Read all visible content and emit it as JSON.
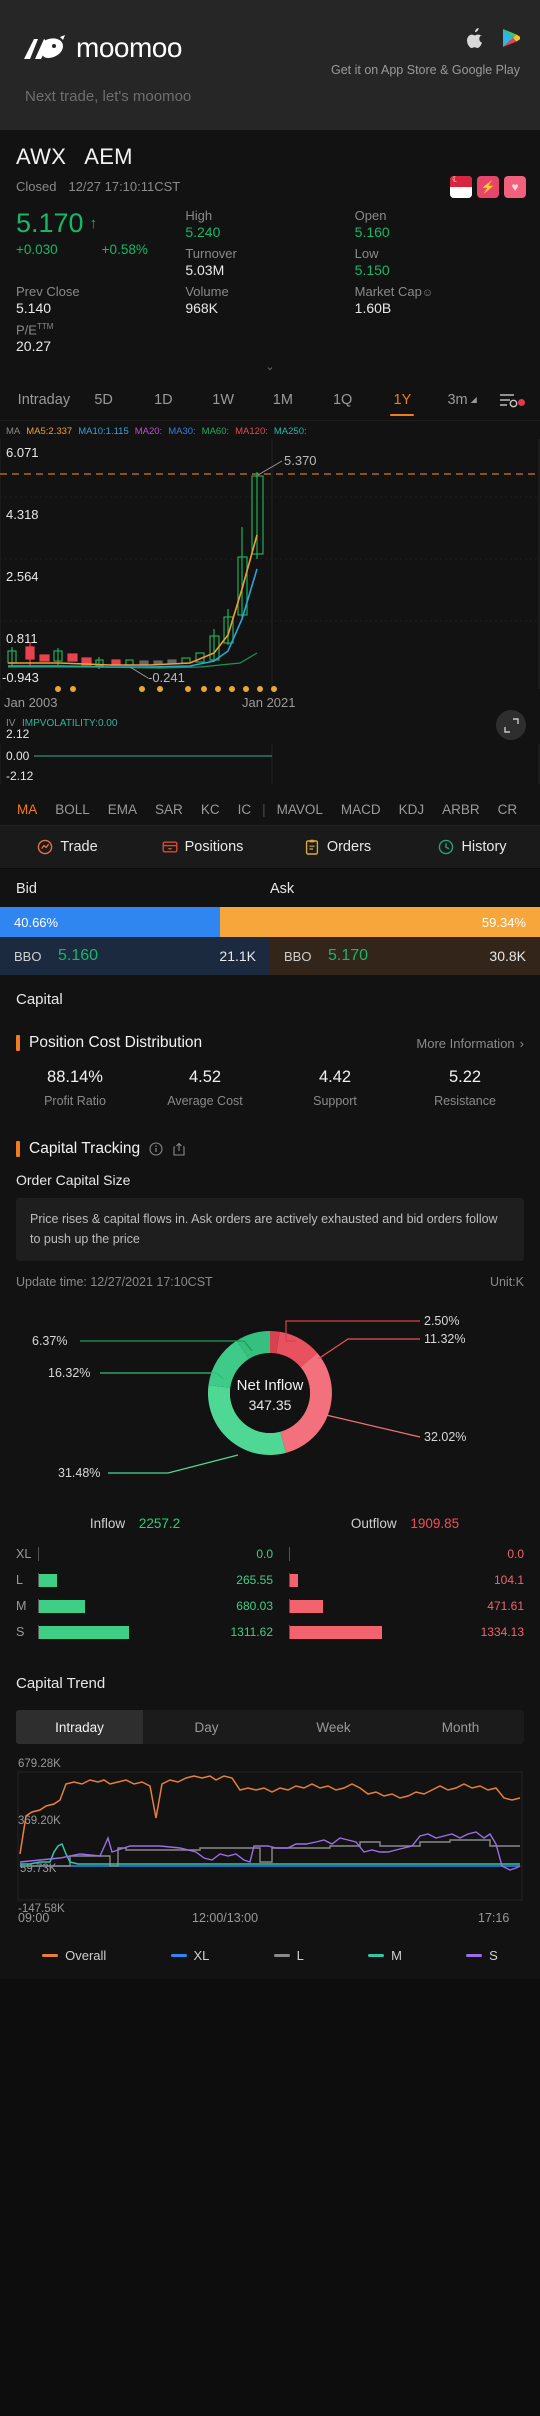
{
  "promo": {
    "brand": "moomoo",
    "tagline": "Next trade, let's moomoo",
    "store_text": "Get it on App Store & Google Play",
    "apple_icon": "apple-icon",
    "googleplay_icon": "google-play-icon"
  },
  "ticker": {
    "symbol": "AWX",
    "market": "AEM",
    "status": "Closed",
    "timestamp": "12/27 17:10:11CST",
    "badges": [
      "sg-flag-badge",
      "level1-badge",
      "watchlist-heart-badge"
    ]
  },
  "quote": {
    "price": "5.170",
    "arrow": "↑",
    "change": "+0.030",
    "change_pct": "+0.58%",
    "stats": [
      {
        "label": "High",
        "value": "5.240",
        "cls": "up"
      },
      {
        "label": "Open",
        "value": "5.160",
        "cls": "up"
      },
      {
        "label": "Turnover",
        "value": "5.03M",
        "cls": ""
      },
      {
        "label": "Low",
        "value": "5.150",
        "cls": "up"
      },
      {
        "label": "Prev Close",
        "value": "5.140",
        "cls": ""
      },
      {
        "label": "Volume",
        "value": "968K",
        "cls": ""
      },
      {
        "label": "Market Cap",
        "value": "1.60B",
        "cls": ""
      },
      {
        "label": "P/E",
        "value": "20.27",
        "cls": ""
      }
    ],
    "market_cap_info": "☺",
    "pe_sup": "TTM",
    "expand_caret": "⌄"
  },
  "timeframes": {
    "items": [
      "Intraday",
      "5D",
      "1D",
      "1W",
      "1M",
      "1Q",
      "1Y",
      "3m"
    ],
    "active": "1Y",
    "caret": "◢",
    "settings_icon": "chart-settings-icon"
  },
  "chart": {
    "ma_prefix": "MA",
    "ma_items": [
      {
        "label": "MA5:2.337",
        "color": "#f0a030"
      },
      {
        "label": "MA10:1.115",
        "color": "#2ea3d8"
      },
      {
        "label": "MA20:",
        "color": "#c24bd8"
      },
      {
        "label": "MA30:",
        "color": "#2f7fe8"
      },
      {
        "label": "MA60:",
        "color": "#1fae5a"
      },
      {
        "label": "MA120:",
        "color": "#e04a58"
      },
      {
        "label": "MA250:",
        "color": "#1fb8a8"
      }
    ],
    "y_labels": [
      "6.071",
      "4.318",
      "2.564",
      "0.811",
      "-0.943"
    ],
    "x_labels": [
      "Jan 2003",
      "Jan 2021"
    ],
    "callout_high": "5.370",
    "callout_low": "-0.241",
    "iv_prefix": "IV",
    "iv_label": "IMPVOLATILITY:0.00",
    "iv_y": [
      "2.12",
      "0.00",
      "-2.12"
    ],
    "expand_icon": "expand-chart-icon",
    "indicators_left": [
      "MA",
      "BOLL",
      "EMA",
      "SAR",
      "KC",
      "IC"
    ],
    "indicators_right": [
      "MAVOL",
      "MACD",
      "KDJ",
      "ARBR",
      "CR"
    ],
    "indicator_active": "MA",
    "indicator_sep": "|"
  },
  "actions": [
    {
      "label": "Trade",
      "icon": "trade-icon",
      "color": "#e8704a"
    },
    {
      "label": "Positions",
      "icon": "positions-icon",
      "color": "#d8483a"
    },
    {
      "label": "Orders",
      "icon": "orders-icon",
      "color": "#d8a93a"
    },
    {
      "label": "History",
      "icon": "history-clock-icon",
      "color": "#2a9e7e"
    }
  ],
  "bidask": {
    "bid_label": "Bid",
    "ask_label": "Ask",
    "bid_pct": "40.66%",
    "ask_pct": "59.34%",
    "bid_pct_num": 40.66,
    "ask_pct_num": 59.34,
    "bid_tag": "BBO",
    "bid_price": "5.160",
    "bid_qty": "21.1K",
    "ask_tag": "BBO",
    "ask_price": "5.170",
    "ask_qty": "30.8K",
    "bar_bid_color": "#2f86f0",
    "bar_ask_color": "#f7a63b"
  },
  "capital": {
    "title": "Capital"
  },
  "pcd": {
    "title": "Position Cost Distribution",
    "more": "More Information",
    "chevron": "›",
    "metrics": [
      {
        "value": "88.14%",
        "label": "Profit Ratio"
      },
      {
        "value": "4.52",
        "label": "Average Cost"
      },
      {
        "value": "4.42",
        "label": "Support"
      },
      {
        "value": "5.22",
        "label": "Resistance"
      }
    ]
  },
  "tracking": {
    "title": "Capital Tracking",
    "info_icon": "info-circle-icon",
    "share_icon": "share-icon",
    "subtitle": "Order Capital Size",
    "notice": "Price rises & capital flows in. Ask orders are actively exhausted and bid orders follow to push up the price",
    "update_prefix": "Update time:",
    "update_time": "12/27/2021 17:10CST",
    "unit": "Unit:K"
  },
  "chart_data": {
    "type": "pie",
    "title": "Net Inflow",
    "center_label": "Net Inflow",
    "center_value": "347.35",
    "labels": [
      "6.37%",
      "16.32%",
      "31.48%",
      "32.02%",
      "11.32%",
      "2.50%"
    ],
    "values": [
      6.37,
      16.32,
      31.48,
      32.02,
      11.32,
      2.5
    ],
    "colors": [
      "#1c9e52",
      "#2fbf72",
      "#4fd894",
      "#f2717d",
      "#e8525f",
      "#d8414f"
    ],
    "legend_position": "labels-outside",
    "inflow_label": "Inflow",
    "inflow_total": "2257.2",
    "outflow_label": "Outflow",
    "outflow_total": "1909.85",
    "flow_rows": [
      {
        "key": "XL",
        "in": "0.0",
        "out": "0.0",
        "in_num": 0.0,
        "out_num": 0.0
      },
      {
        "key": "L",
        "in": "265.55",
        "out": "104.1",
        "in_num": 265.55,
        "out_num": 104.1
      },
      {
        "key": "M",
        "in": "680.03",
        "out": "471.61",
        "in_num": 680.03,
        "out_num": 471.61
      },
      {
        "key": "S",
        "in": "1311.62",
        "out": "1334.13",
        "in_num": 1311.62,
        "out_num": 1334.13
      }
    ]
  },
  "trend": {
    "title": "Capital Trend",
    "tabs": [
      "Intraday",
      "Day",
      "Week",
      "Month"
    ],
    "active_tab": "Intraday",
    "y_labels": [
      "679.28K",
      "369.20K",
      "59.73K",
      "-147.58K"
    ],
    "y_mid_label": "59.73K",
    "x_labels": [
      "09:00",
      "12:00/13:00",
      "17:16"
    ],
    "legend": [
      {
        "label": "Overall",
        "color": "#e8803a"
      },
      {
        "label": "XL",
        "color": "#2f86f0"
      },
      {
        "label": "L",
        "color": "#8a8a8a"
      },
      {
        "label": "M",
        "color": "#2fc8a8"
      },
      {
        "label": "S",
        "color": "#9b6fe8"
      }
    ]
  }
}
